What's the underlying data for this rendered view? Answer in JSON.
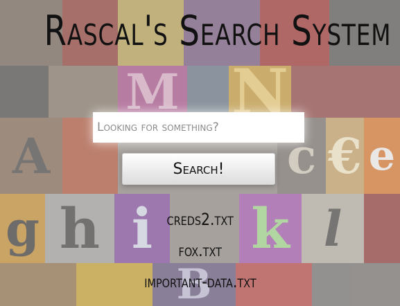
{
  "page": {
    "title": "Rascal's Search System"
  },
  "search": {
    "placeholder": "Looking for something?",
    "value": "",
    "button_label": "Search!"
  },
  "results": {
    "files": [
      {
        "name": "creds2.txt"
      },
      {
        "name": "fox.txt"
      },
      {
        "name": "important-data.txt"
      }
    ]
  },
  "colors": {
    "title_text": "#111111",
    "input_bg": "#ffffff",
    "button_gradient_top": "#ffffff",
    "button_gradient_bottom": "#dcdcdc"
  },
  "background": {
    "letters": [
      "A",
      "N",
      "c",
      "e",
      "€",
      "g",
      "h",
      "i",
      "k",
      "l",
      "B",
      "M"
    ]
  }
}
